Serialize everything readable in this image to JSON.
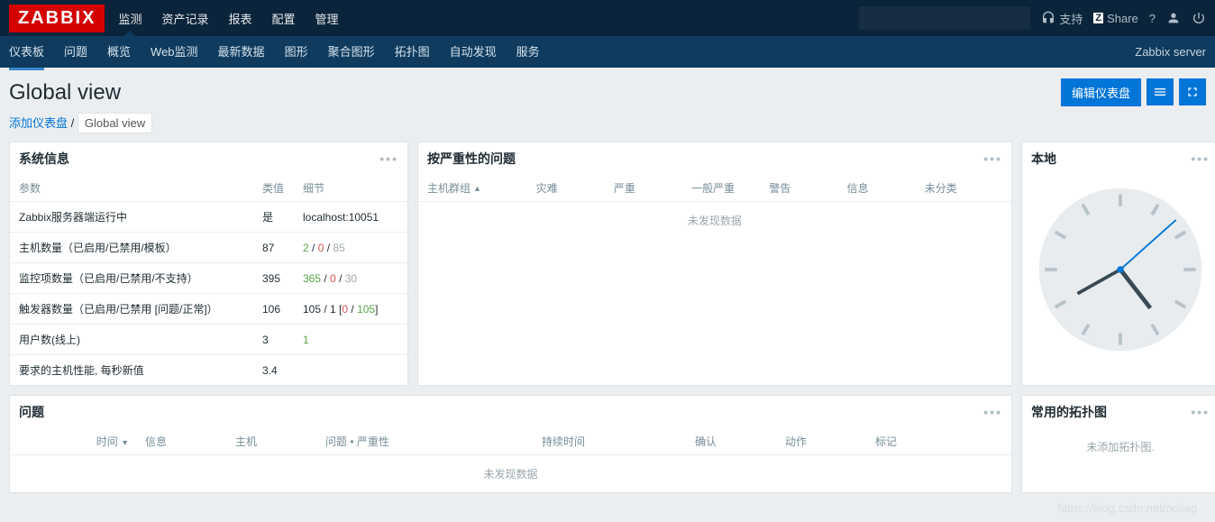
{
  "logo": "ZABBIX",
  "topnav": [
    "监测",
    "资产记录",
    "报表",
    "配置",
    "管理"
  ],
  "topnav_active": 0,
  "support_label": "支持",
  "share_label": "Share",
  "subnav": [
    "仪表板",
    "问题",
    "概览",
    "Web监测",
    "最新数据",
    "图形",
    "聚合图形",
    "拓扑图",
    "自动发现",
    "服务"
  ],
  "subnav_active": 0,
  "server_label": "Zabbix server",
  "page_title": "Global view",
  "edit_btn": "编辑仪表盘",
  "crumb_add": "添加仪表盘",
  "crumb_sep": "/",
  "crumb_curr": "Global view",
  "sysinfo": {
    "title": "系统信息",
    "cols": [
      "参数",
      "类值",
      "细节"
    ],
    "rows": [
      {
        "p": "Zabbix服务器端运行中",
        "v": {
          "text": "是",
          "cls": "g"
        },
        "d": [
          {
            "text": "localhost:10051",
            "cls": ""
          }
        ]
      },
      {
        "p": "主机数量（已启用/已禁用/模板）",
        "v": {
          "text": "87",
          "cls": ""
        },
        "d": [
          {
            "text": "2",
            "cls": "g"
          },
          {
            "text": " / ",
            "cls": ""
          },
          {
            "text": "0",
            "cls": "r"
          },
          {
            "text": " / ",
            "cls": ""
          },
          {
            "text": "85",
            "cls": "gr"
          }
        ]
      },
      {
        "p": "监控项数量（已启用/已禁用/不支持）",
        "v": {
          "text": "395",
          "cls": ""
        },
        "d": [
          {
            "text": "365",
            "cls": "g"
          },
          {
            "text": " / ",
            "cls": ""
          },
          {
            "text": "0",
            "cls": "r"
          },
          {
            "text": " / ",
            "cls": ""
          },
          {
            "text": "30",
            "cls": "gr"
          }
        ]
      },
      {
        "p": "触发器数量（已启用/已禁用 [问题/正常]）",
        "v": {
          "text": "106",
          "cls": ""
        },
        "d": [
          {
            "text": "105 / 1 [",
            "cls": ""
          },
          {
            "text": "0",
            "cls": "r"
          },
          {
            "text": " / ",
            "cls": ""
          },
          {
            "text": "105",
            "cls": "g"
          },
          {
            "text": "]",
            "cls": ""
          }
        ]
      },
      {
        "p": "用户数(线上)",
        "v": {
          "text": "3",
          "cls": ""
        },
        "d": [
          {
            "text": "1",
            "cls": "g"
          }
        ]
      },
      {
        "p": "要求的主机性能, 每秒新值",
        "v": {
          "text": "3.4",
          "cls": ""
        },
        "d": []
      }
    ]
  },
  "severity": {
    "title": "按严重性的问题",
    "cols": [
      "主机群组",
      "灾难",
      "严重",
      "一般严重",
      "警告",
      "信息",
      "未分类"
    ],
    "nodata": "未发现数据"
  },
  "clock": {
    "title": "本地"
  },
  "problems": {
    "title": "问题",
    "cols": [
      "时间",
      "信息",
      "主机",
      "问题 • 严重性",
      "持续时间",
      "确认",
      "动作",
      "标记"
    ],
    "nodata": "未发现数据"
  },
  "maps": {
    "title": "常用的拓扑图",
    "empty": "未添加拓扑图."
  },
  "watermark": "https://blog.csdn.net/noliag"
}
